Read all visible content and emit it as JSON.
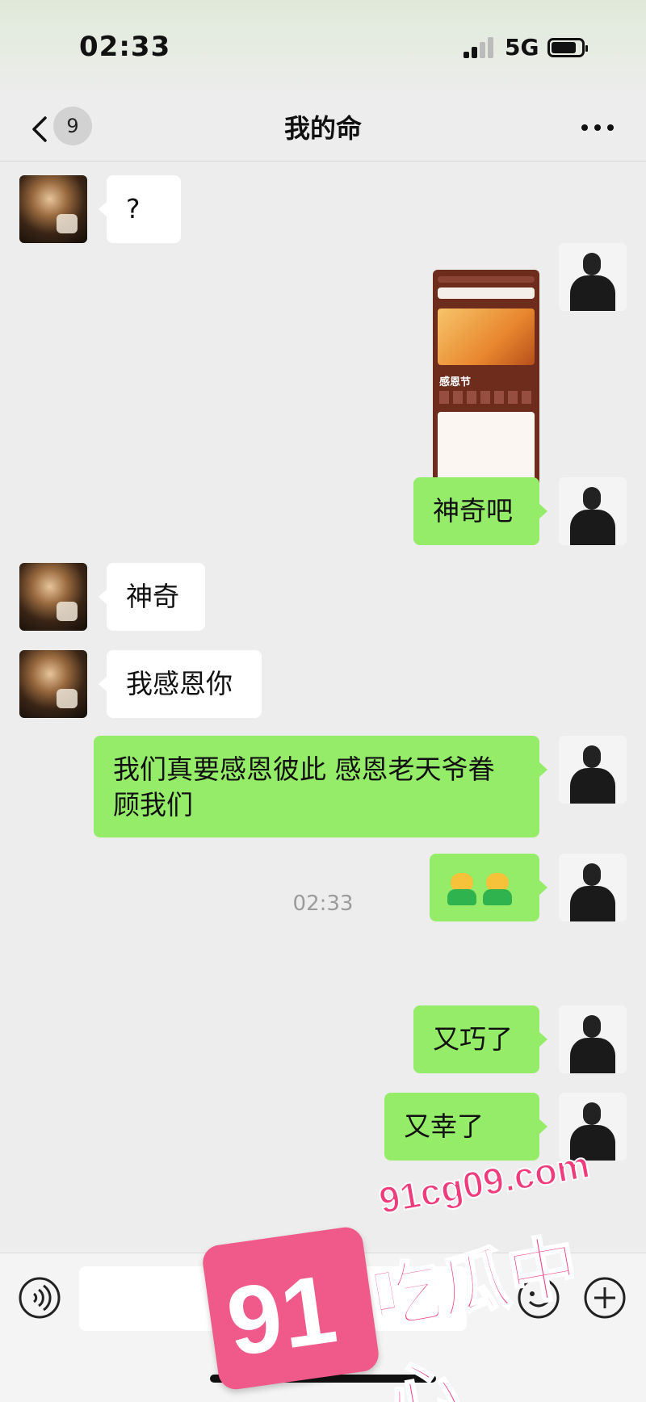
{
  "status_bar": {
    "time": "02:33",
    "network": "5G"
  },
  "header": {
    "back_badge": "9",
    "title": "我的命"
  },
  "messages": [
    {
      "side": "left",
      "type": "text",
      "text": "?"
    },
    {
      "side": "right",
      "type": "image",
      "image_title": "感恩节"
    },
    {
      "side": "right",
      "type": "text",
      "text": "神奇吧"
    },
    {
      "side": "left",
      "type": "text",
      "text": "神奇"
    },
    {
      "side": "left",
      "type": "text",
      "text": "我感恩你"
    },
    {
      "side": "right",
      "type": "text",
      "text": "我们真要感恩彼此 感恩老天爷眷顾我们"
    },
    {
      "side": "right",
      "type": "emoji",
      "emoji": [
        "hugging-person-emoji",
        "hugging-person-emoji"
      ]
    },
    {
      "side": "right",
      "type": "text",
      "text": "又巧了"
    },
    {
      "side": "right",
      "type": "text",
      "text": "又幸了"
    }
  ],
  "time_divider": "02:33",
  "input": {
    "placeholder": ""
  },
  "watermark": {
    "number": "91",
    "url": "91cg09.com",
    "name": "吃瓜中心"
  },
  "colors": {
    "sent_bubble": "#95ec69",
    "received_bubble": "#ffffff",
    "background": "#ededed"
  }
}
